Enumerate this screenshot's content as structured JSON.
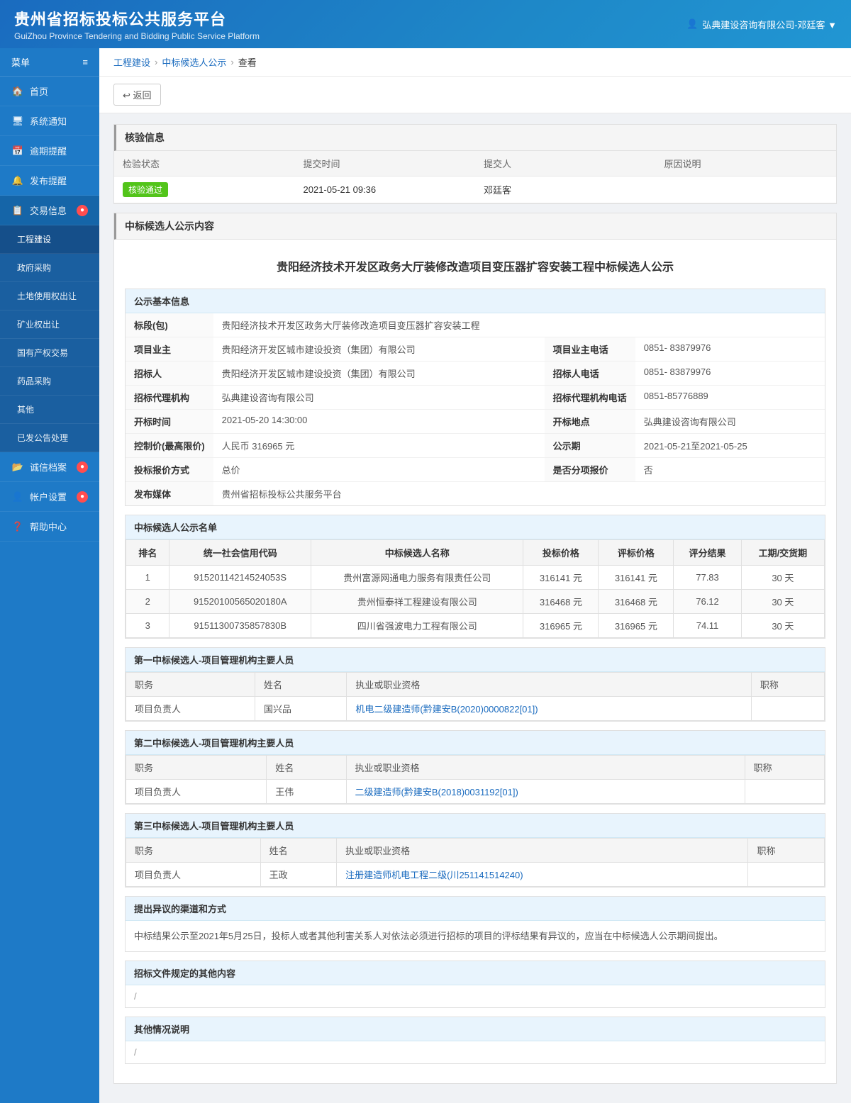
{
  "header": {
    "title": "贵州省招标投标公共服务平台",
    "subtitle": "GuiZhou Province Tendering and Bidding Public Service Platform",
    "user": "弘典建设咨询有限公司-邓廷客 ▼"
  },
  "sidebar": {
    "menu_label": "菜单",
    "items": [
      {
        "id": "home",
        "label": "首页",
        "icon": "home",
        "active": false
      },
      {
        "id": "sys-notify",
        "label": "系统通知",
        "icon": "monitor",
        "active": false
      },
      {
        "id": "overdue",
        "label": "逾期提醒",
        "icon": "calendar",
        "active": false
      },
      {
        "id": "publish",
        "label": "发布提醒",
        "icon": "bell",
        "active": false
      },
      {
        "id": "trade",
        "label": "交易信息",
        "icon": "trade",
        "active": true,
        "badge": true
      }
    ],
    "trade_submenu": [
      {
        "id": "engineering",
        "label": "工程建设",
        "active": true
      },
      {
        "id": "gov-purchase",
        "label": "政府采购",
        "active": false
      },
      {
        "id": "land",
        "label": "土地使用权出让",
        "active": false
      },
      {
        "id": "mining",
        "label": "矿业权出让",
        "active": false
      },
      {
        "id": "state-assets",
        "label": "国有产权交易",
        "active": false
      },
      {
        "id": "medicine",
        "label": "药品采购",
        "active": false
      },
      {
        "id": "other",
        "label": "其他",
        "active": false
      },
      {
        "id": "processed",
        "label": "已发公告处理",
        "active": false
      }
    ],
    "bottom_items": [
      {
        "id": "credit",
        "label": "诚信档案",
        "badge": true
      },
      {
        "id": "account",
        "label": "帐户设置",
        "badge": true
      },
      {
        "id": "help",
        "label": "帮助中心"
      }
    ]
  },
  "breadcrumb": {
    "items": [
      "工程建设",
      "中标候选人公示",
      "查看"
    ]
  },
  "back_btn": "↩ 返回",
  "verify_section": {
    "title": "核验信息",
    "headers": [
      "检验状态",
      "提交时间",
      "提交人",
      "原因说明"
    ],
    "status": "核验通过",
    "submit_time": "2021-05-21 09:36",
    "submitter": "邓廷客",
    "reason": ""
  },
  "announcement_section": {
    "title": "中标候选人公示内容",
    "page_title": "贵阳经济技术开发区政务大厅装修改造项目变压器扩容安装工程中标候选人公示",
    "basic_info": {
      "section_title": "公示基本信息",
      "rows": [
        {
          "label": "标段(包)",
          "value": "贵阳经济技术开发区政务大厅装修改造项目变压器扩容安装工程",
          "colspan": true
        },
        {
          "label": "项目业主",
          "value": "贵阳经济开发区城市建设投资（集团）有限公司",
          "label2": "项目业主电话",
          "value2": "0851- 83879976"
        },
        {
          "label": "招标人",
          "value": "贵阳经济开发区城市建设投资（集团）有限公司",
          "label2": "招标人电话",
          "value2": "0851- 83879976"
        },
        {
          "label": "招标代理机构",
          "value": "弘典建设咨询有限公司",
          "label2": "招标代理机构电话",
          "value2": "0851-85776889"
        },
        {
          "label": "开标时间",
          "value": "2021-05-20 14:30:00",
          "label2": "开标地点",
          "value2": "弘典建设咨询有限公司"
        },
        {
          "label": "控制价(最高限价)",
          "value": "人民币 316965 元",
          "label2": "公示期",
          "value2": "2021-05-21至2021-05-25"
        },
        {
          "label": "投标报价方式",
          "value": "总价",
          "label2": "是否分项报价",
          "value2": "否"
        },
        {
          "label": "发布媒体",
          "value": "贵州省招标投标公共服务平台",
          "colspan": true
        }
      ]
    },
    "candidates": {
      "section_title": "中标候选人公示名单",
      "headers": [
        "排名",
        "统一社会信用代码",
        "中标候选人名称",
        "投标价格",
        "评标价格",
        "评分结果",
        "工期/交货期"
      ],
      "rows": [
        {
          "rank": "1",
          "code": "91520114214524053S",
          "name": "贵州富源网通电力服务有限责任公司",
          "bid_price": "316141 元",
          "eval_price": "316141 元",
          "score": "77.83",
          "period": "30 天"
        },
        {
          "rank": "2",
          "code": "91520100565020180A",
          "name": "贵州恒泰祥工程建设有限公司",
          "bid_price": "316468 元",
          "eval_price": "316468 元",
          "score": "76.12",
          "period": "30 天"
        },
        {
          "rank": "3",
          "code": "91511300735857830B",
          "name": "四川省强波电力工程有限公司",
          "bid_price": "316965 元",
          "eval_price": "316965 元",
          "score": "74.11",
          "period": "30 天"
        }
      ]
    },
    "first_candidate": {
      "section_title": "第一中标候选人-项目管理机构主要人员",
      "headers": [
        "职务",
        "姓名",
        "执业或职业资格",
        "职称"
      ],
      "rows": [
        {
          "role": "项目负责人",
          "name": "国兴品",
          "qualification": "机电二级建造师(黔建安B(2020)0000822[01])",
          "title": ""
        }
      ]
    },
    "second_candidate": {
      "section_title": "第二中标候选人-项目管理机构主要人员",
      "headers": [
        "职务",
        "姓名",
        "执业或职业资格",
        "职称"
      ],
      "rows": [
        {
          "role": "项目负责人",
          "name": "王伟",
          "qualification": "二级建造师(黔建安B(2018)0031192[01])",
          "title": ""
        }
      ]
    },
    "third_candidate": {
      "section_title": "第三中标候选人-项目管理机构主要人员",
      "headers": [
        "职务",
        "姓名",
        "执业或职业资格",
        "职称"
      ],
      "rows": [
        {
          "role": "项目负责人",
          "name": "王政",
          "qualification": "注册建造师机电工程二级(川251141514240)",
          "title": ""
        }
      ]
    },
    "dispute": {
      "section_title": "提出异议的渠道和方式",
      "text": "中标结果公示至2021年5月25日，投标人或者其他利害关系人对依法必须进行招标的项目的评标结果有异议的，应当在中标候选人公示期间提出。"
    },
    "other_docs": {
      "section_title": "招标文件规定的其他内容",
      "content": "/"
    },
    "other_info": {
      "section_title": "其他情况说明",
      "content": "/"
    }
  }
}
